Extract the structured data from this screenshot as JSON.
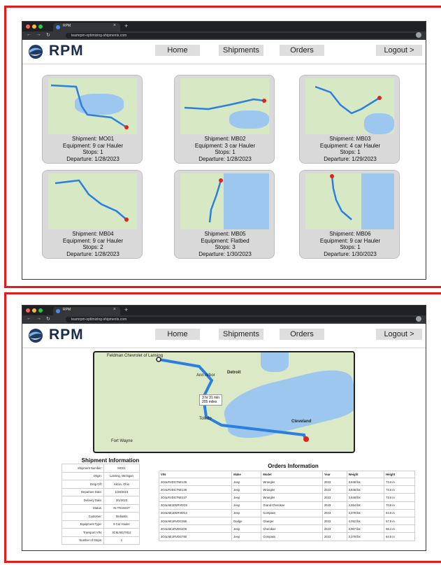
{
  "browser": {
    "tab_title": "RPM",
    "url": "teamrpm-optimizing-shipments.com"
  },
  "nav": {
    "brand": "RPM",
    "home": "Home",
    "shipments": "Shipments",
    "orders": "Orders",
    "logout": "Logout >"
  },
  "shipments": [
    {
      "shipment": "Shipment: MO01",
      "equipment": "Equipment: 9 car Hauler",
      "stops": "Stops: 1",
      "departure": "Departure: 1/28/2023"
    },
    {
      "shipment": "Shipment: MB02",
      "equipment": "Equipment: 3 car Hauler",
      "stops": "Stops: 1",
      "departure": "Departure: 1/28/2023"
    },
    {
      "shipment": "Shipment: MB03",
      "equipment": "Equipment: 4 car Hauler",
      "stops": "Stops: 1",
      "departure": "Departure: 1/29/2023"
    },
    {
      "shipment": "Shipment: MB04",
      "equipment": "Equipment: 9 car Hauler",
      "stops": "Stops: 2",
      "departure": "Departure: 1/28/2023"
    },
    {
      "shipment": "Shipment: MB05",
      "equipment": "Equipment: Flatbed",
      "stops": "Stops: 3",
      "departure": "Departure: 1/30/2023"
    },
    {
      "shipment": "Shipment: MB06",
      "equipment": "Equipment: 9 car Hauler",
      "stops": "Stops: 1",
      "departure": "Departure: 1/30/2023"
    }
  ],
  "map_labels": {
    "origin": "Feldman Chevrolet of Lansing",
    "ann_arbor": "Ann Arbor",
    "detroit": "Detroit",
    "toledo": "Toledo",
    "cleveland": "Cleveland",
    "fort_wayne": "Fort Wayne",
    "eta_time": "3 hr 31 min",
    "eta_dist": "205 miles"
  },
  "shipment_info": {
    "title": "Shipment Information",
    "rows": [
      {
        "k": "Shipment Number:",
        "v": "MO01"
      },
      {
        "k": "Origin:",
        "v": "Lansing, Michigan"
      },
      {
        "k": "Drop Off:",
        "v": "Akron, Ohio"
      },
      {
        "k": "Departure Date:",
        "v": "1/28/2023"
      },
      {
        "k": "Delivery Date:",
        "v": "2/1/2023"
      },
      {
        "k": "Status:",
        "v": "IN TRANSIT"
      },
      {
        "k": "Customer:",
        "v": "Stellantis"
      },
      {
        "k": "Equipment Type:",
        "v": "9 Car Hauler"
      },
      {
        "k": "Transport VIN:",
        "v": "3C6LNEJ7812"
      },
      {
        "k": "Number of Stops:",
        "v": "1"
      }
    ]
  },
  "orders_info": {
    "title": "Orders Information",
    "columns": [
      "VIN",
      "Make",
      "Model",
      "Year",
      "Weight",
      "Height"
    ],
    "rows": [
      [
        "3C6LRVDG7NE135",
        "Jeep",
        "Wrangler",
        "2023",
        "3,848 lbs",
        "73.6 in"
      ],
      [
        "3C6LRVDG7NE136",
        "Jeep",
        "Wrangler",
        "2023",
        "3,848 lbs",
        "73.6 in"
      ],
      [
        "3C6LRVDG7NE137",
        "Jeep",
        "Wrangler",
        "2023",
        "3,848 lbs",
        "73.6 in"
      ],
      [
        "3C6LNE1D5RVDG9",
        "Jeep",
        "Grand Cherokee",
        "2023",
        "4,654 lbs",
        "70.8 in"
      ],
      [
        "3C6LNE1D5RVDG4",
        "Jeep",
        "Compass",
        "2023",
        "3,379 lbs",
        "64.8 in"
      ],
      [
        "3C6LNE1RVDG365",
        "Dodge",
        "Charger",
        "2023",
        "4,052 lbs",
        "57.8 in"
      ],
      [
        "3C6LNE1RVDG205",
        "Jeep",
        "Cherokee",
        "2023",
        "3,967 lbs",
        "66.2 in"
      ],
      [
        "3C6LNE1RVDG780",
        "Jeep",
        "Compass",
        "2023",
        "3,379 lbs",
        "64.8 in"
      ]
    ]
  }
}
